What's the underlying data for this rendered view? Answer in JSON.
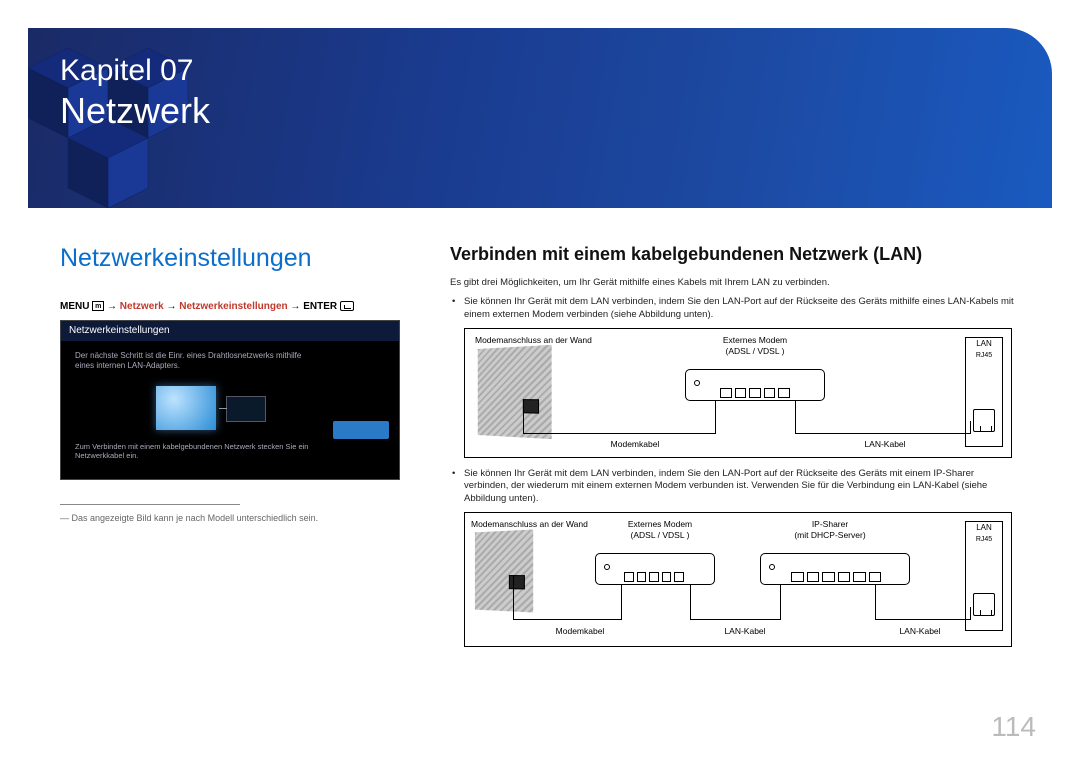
{
  "chapter": {
    "label": "Kapitel 07",
    "title": "Netzwerk"
  },
  "left": {
    "section_title": "Netzwerkeinstellungen",
    "menu_path": {
      "menu": "MENU",
      "arrow": "→",
      "p1": "Netzwerk",
      "p2": "Netzwerkeinstellungen",
      "enter": "ENTER"
    },
    "screenshot": {
      "header": "Netzwerkeinstellungen",
      "text_top": "Der nächste Schritt ist die Einr. eines Drahtlosnetzwerks mithilfe eines internen LAN-Adapters.",
      "text_bottom": "Zum Verbinden mit einem kabelgebundenen Netzwerk stecken Sie ein Netzwerkkabel ein."
    },
    "footnote": "― Das angezeigte Bild kann je nach Modell unterschiedlich sein."
  },
  "right": {
    "section_title": "Verbinden mit einem kabelgebundenen Netzwerk (LAN)",
    "intro": "Es gibt drei Möglichkeiten, um Ihr Gerät mithilfe eines Kabels mit Ihrem LAN zu verbinden.",
    "bullet1": "Sie können Ihr Gerät mit dem LAN verbinden, indem Sie den LAN-Port auf der Rückseite des Geräts mithilfe eines LAN-Kabels mit einem externen Modem verbinden (siehe Abbildung unten).",
    "bullet2": "Sie können Ihr Gerät mit dem LAN verbinden, indem Sie den LAN-Port auf der Rückseite des Geräts mit einem IP-Sharer verbinden, der wiederum mit einem externen Modem verbunden ist. Verwenden Sie für die Verbindung ein LAN-Kabel (siehe Abbildung unten).",
    "diagram1": {
      "wall": "Modemanschluss an der Wand",
      "modem": "Externes Modem",
      "modem_sub": "(ADSL / VDSL )",
      "cable_modem": "Modemkabel",
      "cable_lan": "LAN-Kabel",
      "lan": "LAN",
      "rj45": "RJ45"
    },
    "diagram2": {
      "wall": "Modemanschluss an der Wand",
      "modem": "Externes Modem",
      "modem_sub": "(ADSL / VDSL )",
      "sharer": "IP-Sharer",
      "sharer_sub": "(mit DHCP-Server)",
      "cable_modem": "Modemkabel",
      "cable_lan": "LAN-Kabel",
      "lan": "LAN",
      "rj45": "RJ45"
    }
  },
  "page_number": "114"
}
